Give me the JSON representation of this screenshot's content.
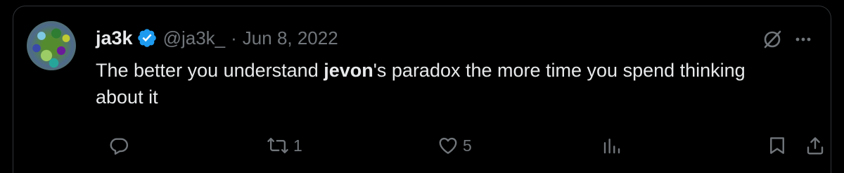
{
  "tweet": {
    "author": {
      "display_name": "ja3k",
      "handle": "@ja3k_",
      "separator": "·",
      "date": "Jun 8, 2022",
      "verified": true
    },
    "text": {
      "before": "The better you understand ",
      "bold": "jevon",
      "after": "'s paradox the more time you spend thinking about it"
    },
    "stats": {
      "replies": "",
      "retweets": "1",
      "likes": "5",
      "views": ""
    }
  },
  "colors": {
    "background": "#000000",
    "text": "#e7e9ea",
    "secondary": "#71767b",
    "verified": "#1d9bf0",
    "border": "#2f3336"
  },
  "icons": [
    "verified-badge-icon",
    "grok-icon",
    "more-icon",
    "reply-icon",
    "retweet-icon",
    "like-icon",
    "views-icon",
    "bookmark-icon",
    "share-icon"
  ]
}
